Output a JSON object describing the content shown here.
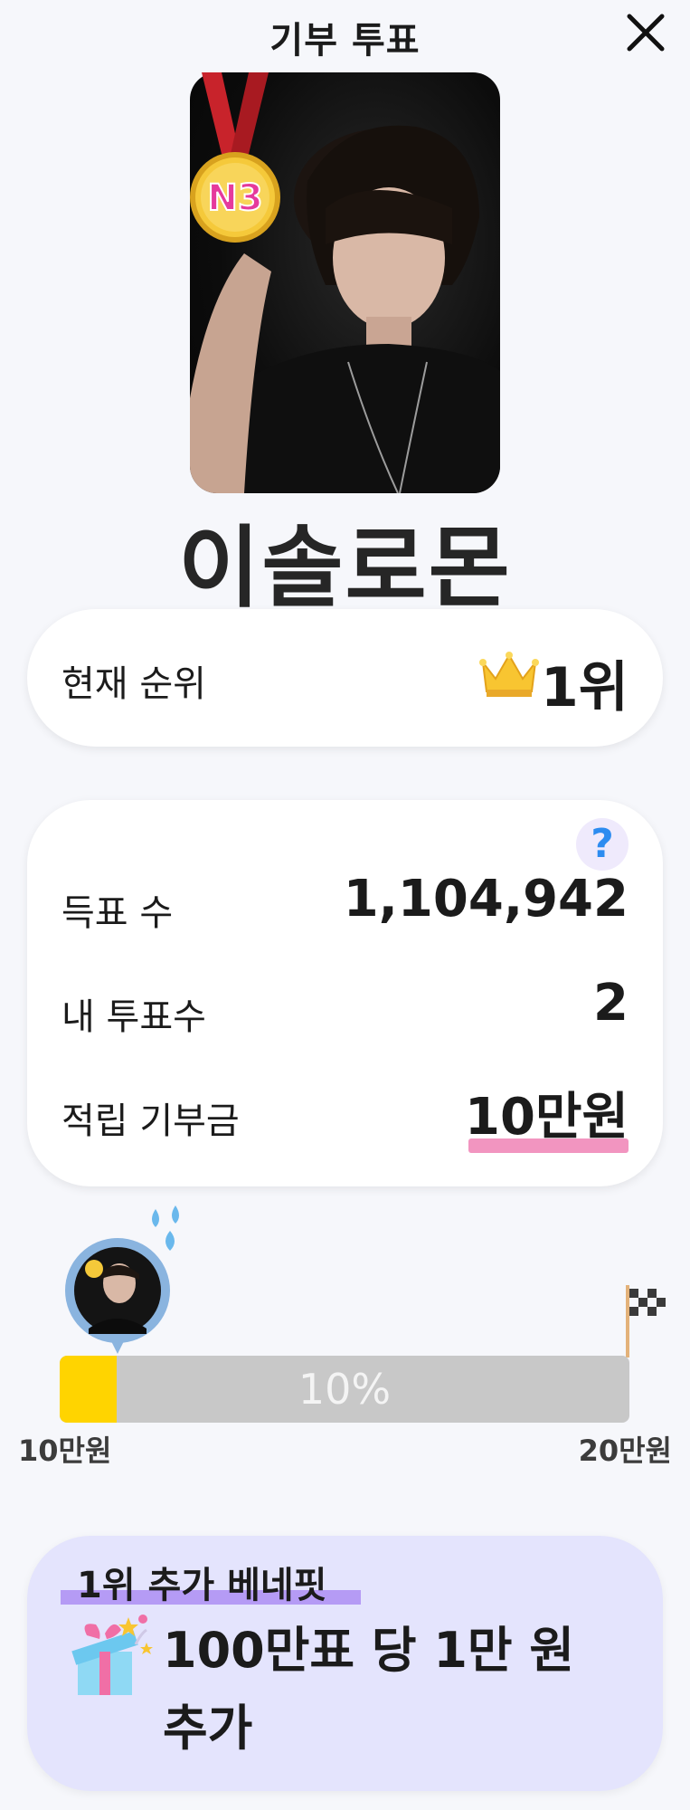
{
  "header": {
    "title": "기부 투표"
  },
  "profile": {
    "name": "이솔로몬",
    "medal_text": "N3"
  },
  "rank": {
    "label": "현재 순위",
    "value": "1위"
  },
  "stats": {
    "help_glyph": "?",
    "votes_label": "득표 수",
    "votes_value": "1,104,942",
    "my_votes_label": "내 투표수",
    "my_votes_value": "2",
    "donation_label": "적립 기부금",
    "donation_value": "10만원"
  },
  "progress": {
    "percent": 10,
    "percent_text": "10%",
    "min_label": "10만원",
    "max_label": "20만원"
  },
  "benefit": {
    "title": "1위 추가 베네핏",
    "line1": "100만표 당 1만 원",
    "line2": "추가"
  },
  "colors": {
    "accent_yellow": "#ffd400",
    "underline_pink": "#f295c0",
    "benefit_bg": "#e4e4fd",
    "help_blue": "#2d8cf0"
  }
}
